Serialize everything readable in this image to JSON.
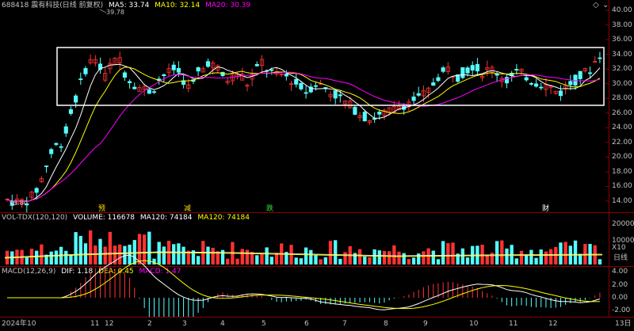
{
  "price_header": {
    "code_title": "688418 震有科技(日线 前复权)",
    "ma5": "MA5: 33.74",
    "ma10": "MA10: 32.14",
    "ma20": "MA20: 30.39"
  },
  "volume_header": {
    "name": "VOL-TDX(120,120)",
    "volume": "VOLUME: 116678",
    "ma120a": "MA120: 74184",
    "ma120b": "MA120: 74184"
  },
  "macd_header": {
    "name": "MACD(12,26,9)",
    "dif": "DIF: 1.18",
    "dea": "DEA: 0.45",
    "macd": "MACD: 1.47"
  },
  "price_axis": [
    "40.00",
    "38.00",
    "36.00",
    "34.00",
    "32.00",
    "30.00",
    "28.00",
    "26.00",
    "24.00",
    "22.00",
    "20.00",
    "18.00",
    "16.00",
    "14.00"
  ],
  "volume_axis": [
    "20000",
    "10000",
    "X10"
  ],
  "macd_axis": [
    "4.00",
    "2.00",
    "0.00",
    "-2.00"
  ],
  "annotations": {
    "high": "39.78",
    "low": "13.80"
  },
  "event_tags": [
    {
      "label": "预",
      "color": "#ffd700"
    },
    {
      "label": "减",
      "color": "#ffd700"
    },
    {
      "label": "跌",
      "color": "#33dd33"
    },
    {
      "label": "财",
      "color": "#ffffff"
    }
  ],
  "period_label": "日线",
  "month_labels": [
    "2024年",
    "10",
    "11",
    "12",
    "2",
    "3",
    "4",
    "5",
    "6",
    "7",
    "8",
    "9",
    "10",
    "11",
    "12"
  ],
  "bottom_right": "13日",
  "colors": {
    "up": "#ff3232",
    "down": "#54ffff",
    "ma5": "#ffffff",
    "ma10": "#ffff00",
    "ma20": "#ff00ff",
    "box": "#ffffff"
  }
}
